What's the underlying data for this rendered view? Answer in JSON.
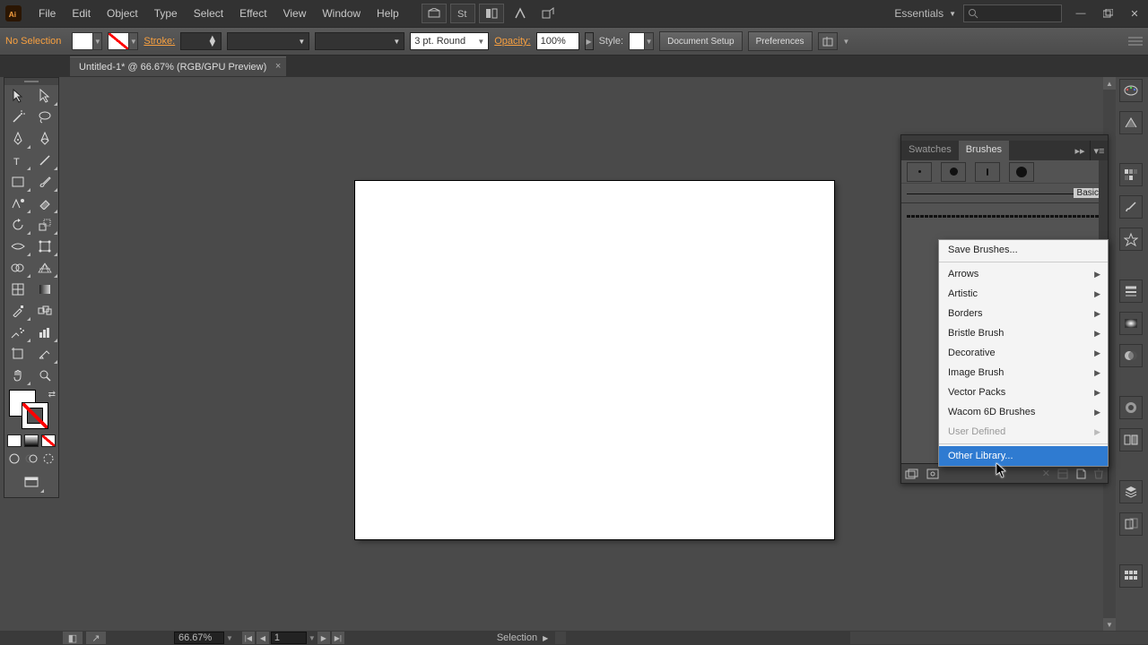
{
  "menubar": {
    "items": [
      "File",
      "Edit",
      "Object",
      "Type",
      "Select",
      "Effect",
      "View",
      "Window",
      "Help"
    ]
  },
  "workspace": {
    "label": "Essentials"
  },
  "controlbar": {
    "selection": "No Selection",
    "stroke_label": "Stroke:",
    "stroke_weight": "",
    "brush_preset": "3 pt. Round",
    "opacity_label": "Opacity:",
    "opacity_value": "100%",
    "style_label": "Style:",
    "doc_setup": "Document Setup",
    "preferences": "Preferences"
  },
  "doctab": {
    "title": "Untitled-1* @ 66.67% (RGB/GPU Preview)"
  },
  "panel": {
    "tabs": {
      "swatches": "Swatches",
      "brushes": "Brushes"
    },
    "basic_label": "Basic"
  },
  "flyout": {
    "save": "Save Brushes...",
    "items": [
      "Arrows",
      "Artistic",
      "Borders",
      "Bristle Brush",
      "Decorative",
      "Image Brush",
      "Vector Packs",
      "Wacom 6D Brushes"
    ],
    "user_defined": "User Defined",
    "other": "Other Library..."
  },
  "statusbar": {
    "zoom": "66.67%",
    "artboard": "1",
    "tool": "Selection"
  }
}
